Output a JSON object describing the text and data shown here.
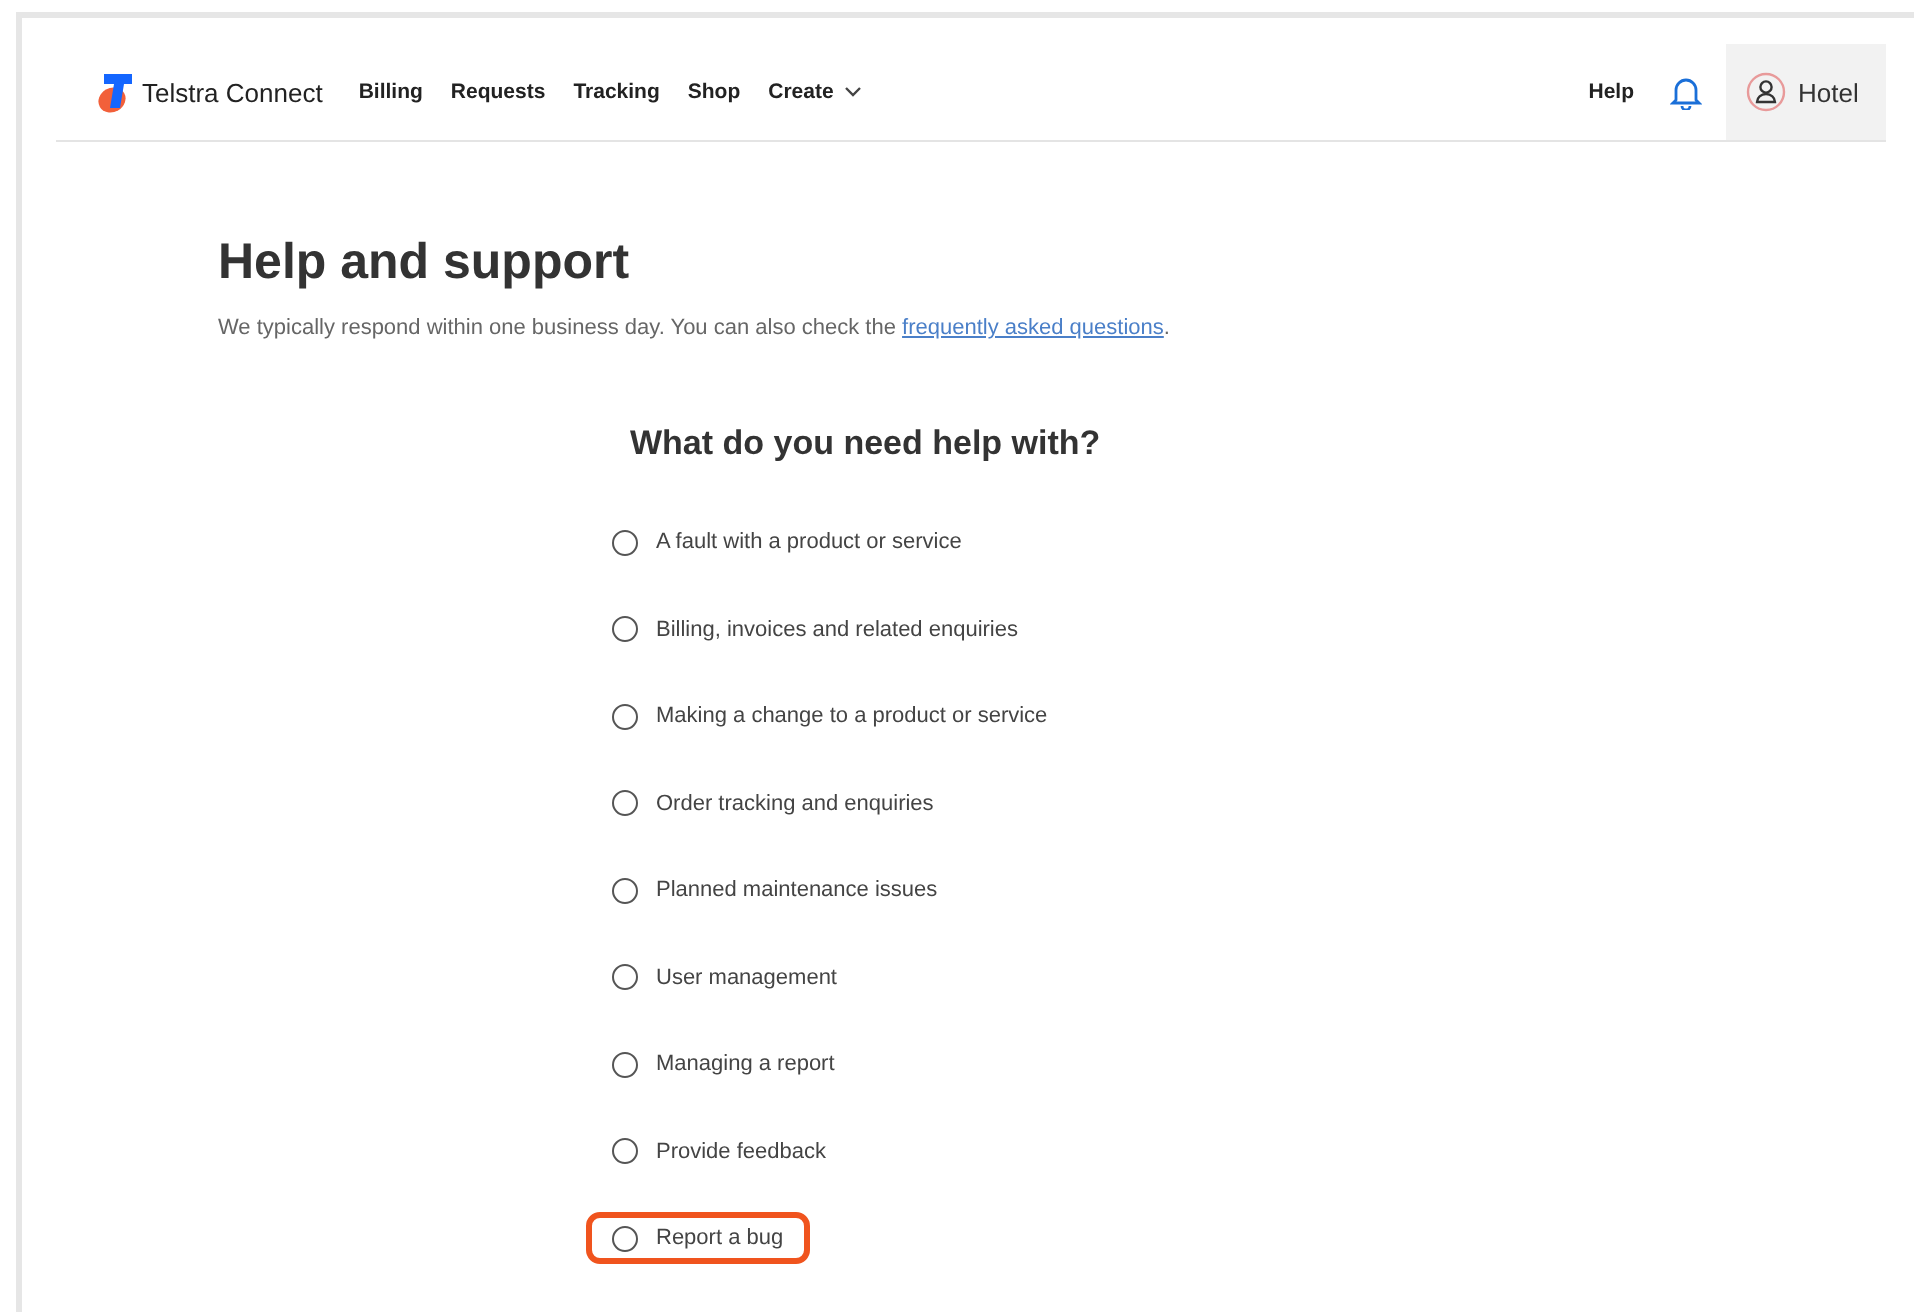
{
  "nav": {
    "brand": "Telstra Connect",
    "links": [
      "Billing",
      "Requests",
      "Tracking",
      "Shop"
    ],
    "create": "Create",
    "help": "Help",
    "user": "Hotel"
  },
  "heading": "Help and support",
  "intro": {
    "text": "We typically respond within one business day. You can also check the ",
    "link": "frequently asked questions",
    "after": "."
  },
  "question": "What do you need help with?",
  "options": [
    {
      "label": "A fault with a product or service",
      "selected": false,
      "highlighted": false
    },
    {
      "label": "Billing, invoices and related enquiries",
      "selected": false,
      "highlighted": false
    },
    {
      "label": "Making a change to a product or service",
      "selected": false,
      "highlighted": false
    },
    {
      "label": "Order tracking and enquiries",
      "selected": false,
      "highlighted": false
    },
    {
      "label": "Planned maintenance issues",
      "selected": false,
      "highlighted": false
    },
    {
      "label": "User management",
      "selected": false,
      "highlighted": false
    },
    {
      "label": "Managing a report",
      "selected": false,
      "highlighted": false
    },
    {
      "label": "Provide feedback",
      "selected": false,
      "highlighted": false
    },
    {
      "label": "Report a bug",
      "selected": false,
      "highlighted": true
    }
  ]
}
